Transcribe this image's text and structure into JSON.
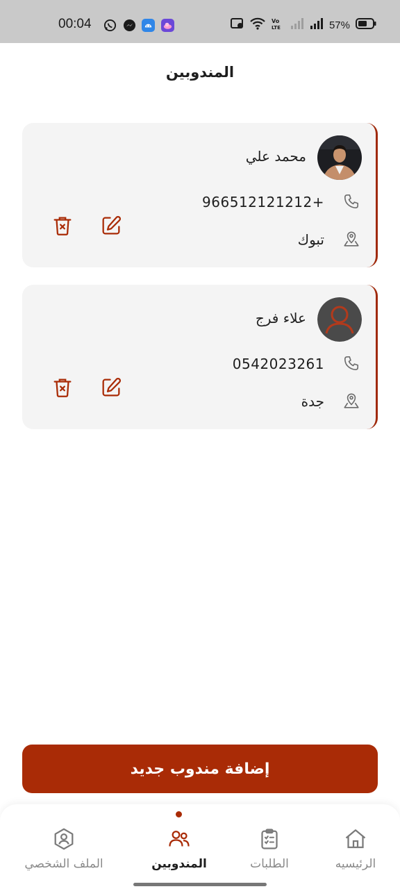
{
  "status_bar": {
    "time": "00:04",
    "battery": "57%",
    "app_icons": [
      "whatsapp-icon",
      "messenger-icon",
      "android-icon",
      "weather-icon"
    ],
    "system_icons": [
      "sim-icon",
      "wifi-icon",
      "volte-icon",
      "signal-icon",
      "signal-icon",
      "battery-icon"
    ]
  },
  "header": {
    "title": "المندوبين"
  },
  "delegates": [
    {
      "name": "محمد علي",
      "phone": "966512121212+",
      "city": "تبوك",
      "avatar": "photo"
    },
    {
      "name": "علاء فرج",
      "phone": "0542023261",
      "city": "جدة",
      "avatar": "placeholder"
    }
  ],
  "actions": {
    "edit_icon": "edit-icon",
    "delete_icon": "trash-icon"
  },
  "add_button": {
    "label": "إضافة مندوب جديد"
  },
  "bottom_nav": {
    "items": [
      {
        "label": "الرئيسيه",
        "icon": "home-icon",
        "active": false
      },
      {
        "label": "الطلبات",
        "icon": "clipboard-icon",
        "active": false
      },
      {
        "label": "المندوبين",
        "icon": "users-icon",
        "active": true
      },
      {
        "label": "الملف الشخصي",
        "icon": "profile-icon",
        "active": false
      }
    ]
  },
  "colors": {
    "accent": "#a92b06",
    "card_bg": "#f4f4f4",
    "text": "#1e1e1e",
    "muted": "#8a8a8a"
  }
}
